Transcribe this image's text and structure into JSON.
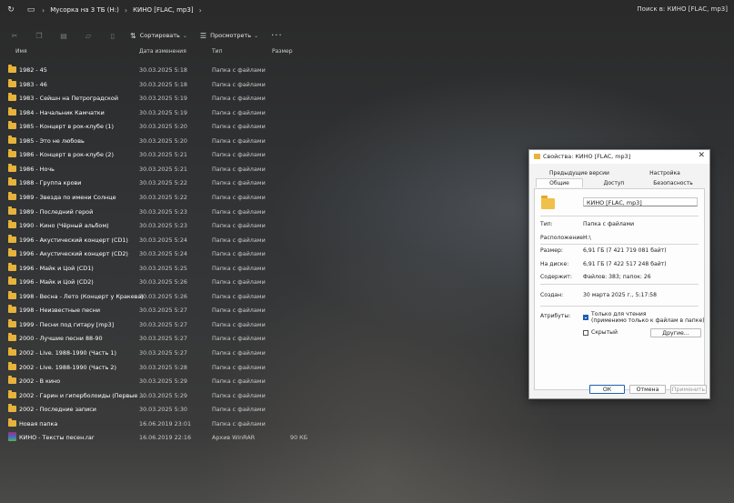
{
  "address": {
    "crumbs": [
      "Мусорка на 3 ТБ (H:)",
      "КИНО [FLAC, mp3]"
    ],
    "search_placeholder": "Поиск в: КИНО [FLAC, mp3]"
  },
  "toolbar": {
    "sort_label": "Сортировать",
    "view_label": "Просмотреть",
    "more_label": "···"
  },
  "columns": {
    "name": "Имя",
    "date": "Дата изменения",
    "type": "Тип",
    "size": "Размер"
  },
  "files": [
    {
      "name": "1982 - 45",
      "date": "30.03.2025 5:18",
      "type": "Папка с файлами",
      "size": ""
    },
    {
      "name": "1983 - 46",
      "date": "30.03.2025 5:18",
      "type": "Папка с файлами",
      "size": ""
    },
    {
      "name": "1983 - Сейшн на Петроградской",
      "date": "30.03.2025 5:19",
      "type": "Папка с файлами",
      "size": ""
    },
    {
      "name": "1984 - Начальник Камчатки",
      "date": "30.03.2025 5:19",
      "type": "Папка с файлами",
      "size": ""
    },
    {
      "name": "1985 - Концерт в рок-клубе (1)",
      "date": "30.03.2025 5:20",
      "type": "Папка с файлами",
      "size": ""
    },
    {
      "name": "1985 - Это не любовь",
      "date": "30.03.2025 5:20",
      "type": "Папка с файлами",
      "size": ""
    },
    {
      "name": "1986 - Концерт в рок-клубе (2)",
      "date": "30.03.2025 5:21",
      "type": "Папка с файлами",
      "size": ""
    },
    {
      "name": "1986 - Ночь",
      "date": "30.03.2025 5:21",
      "type": "Папка с файлами",
      "size": ""
    },
    {
      "name": "1988 - Группа крови",
      "date": "30.03.2025 5:22",
      "type": "Папка с файлами",
      "size": ""
    },
    {
      "name": "1989 - Звезда по имени Солнце",
      "date": "30.03.2025 5:22",
      "type": "Папка с файлами",
      "size": ""
    },
    {
      "name": "1989 - Последний герой",
      "date": "30.03.2025 5:23",
      "type": "Папка с файлами",
      "size": ""
    },
    {
      "name": "1990 - Кино (Чёрный альбом)",
      "date": "30.03.2025 5:23",
      "type": "Папка с файлами",
      "size": ""
    },
    {
      "name": "1996 - Акустический концерт (CD1)",
      "date": "30.03.2025 5:24",
      "type": "Папка с файлами",
      "size": ""
    },
    {
      "name": "1996 - Акустический концерт (CD2)",
      "date": "30.03.2025 5:24",
      "type": "Папка с файлами",
      "size": ""
    },
    {
      "name": "1996 - Майк и Цой (CD1)",
      "date": "30.03.2025 5:25",
      "type": "Папка с файлами",
      "size": ""
    },
    {
      "name": "1996 - Майк и Цой (CD2)",
      "date": "30.03.2025 5:26",
      "type": "Папка с файлами",
      "size": ""
    },
    {
      "name": "1998 - Весна - Лето (Концерт у Кракева)",
      "date": "30.03.2025 5:26",
      "type": "Папка с файлами",
      "size": ""
    },
    {
      "name": "1998 - Неизвестные песни",
      "date": "30.03.2025 5:27",
      "type": "Папка с файлами",
      "size": ""
    },
    {
      "name": "1999 - Песни под гитару [mp3]",
      "date": "30.03.2025 5:27",
      "type": "Папка с файлами",
      "size": ""
    },
    {
      "name": "2000 - Лучшие песни 88-90",
      "date": "30.03.2025 5:27",
      "type": "Папка с файлами",
      "size": ""
    },
    {
      "name": "2002 - Live. 1988-1990 (Часть 1)",
      "date": "30.03.2025 5:27",
      "type": "Папка с файлами",
      "size": ""
    },
    {
      "name": "2002 - Live. 1988-1990 (Часть 2)",
      "date": "30.03.2025 5:28",
      "type": "Папка с файлами",
      "size": ""
    },
    {
      "name": "2002 - В кино",
      "date": "30.03.2025 5:29",
      "type": "Папка с файлами",
      "size": ""
    },
    {
      "name": "2002 - Гарин и гиперболоиды (Первые ...",
      "date": "30.03.2025 5:29",
      "type": "Папка с файлами",
      "size": ""
    },
    {
      "name": "2002 - Последние записи",
      "date": "30.03.2025 5:30",
      "type": "Папка с файлами",
      "size": ""
    },
    {
      "name": "Новая папка",
      "date": "16.06.2019 23:01",
      "type": "Папка с файлами",
      "size": ""
    },
    {
      "name": "КИНО - Тексты песен.rar",
      "date": "16.06.2019 22:16",
      "type": "Архив WinRAR",
      "size": "90 КБ"
    }
  ],
  "dialog": {
    "title": "Свойства: КИНО [FLAC, mp3]",
    "tabs": {
      "prev_versions": "Предыдущие версии",
      "settings": "Настройка",
      "general": "Общие",
      "access": "Доступ",
      "security": "Безопасность"
    },
    "folder_name": "КИНО [FLAC, mp3]",
    "type_label": "Тип:",
    "type_value": "Папка с файлами",
    "location_label": "Расположение:",
    "location_value": "H:\\",
    "size_label": "Размер:",
    "size_value": "6,91 ГБ (7 421 719 081 байт)",
    "disk_label": "На диске:",
    "disk_value": "6,91 ГБ (7 422 517 248 байт)",
    "contains_label": "Содержит:",
    "contains_value": "Файлов: 383; папок: 26",
    "created_label": "Создан:",
    "created_value": "30 марта 2025 г., 5:17:58",
    "attributes_label": "Атрибуты:",
    "readonly_label": "Только для чтения",
    "readonly_note": "(применимо только к файлам в папке)",
    "hidden_label": "Скрытый",
    "other_button": "Другие...",
    "ok": "ОК",
    "cancel": "Отмена",
    "apply": "Применить"
  }
}
